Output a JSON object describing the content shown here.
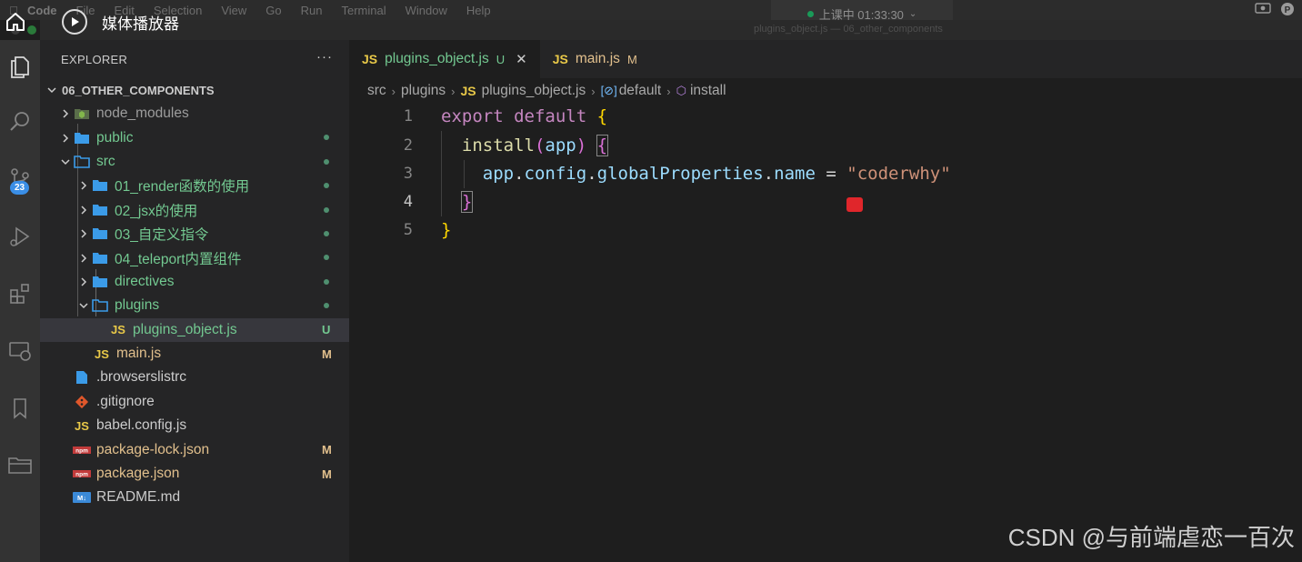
{
  "menubar": {
    "items": [
      "Code",
      "File",
      "Edit",
      "Selection",
      "View",
      "Go",
      "Run",
      "Terminal",
      "Window",
      "Help"
    ]
  },
  "status_pill": {
    "text": "上课中 01:33:30"
  },
  "window_title": "plugins_object.js — 06_other_components",
  "media_overlay": {
    "title": "媒体播放器"
  },
  "activity_bar": {
    "source_control_badge": "23"
  },
  "sidebar": {
    "header": "EXPLORER",
    "more": "···",
    "section": "06_OTHER_COMPONENTS",
    "items": [
      {
        "label": "node_modules",
        "deco": ""
      },
      {
        "label": "public",
        "deco": ""
      },
      {
        "label": "src",
        "deco": ""
      },
      {
        "label": "01_render函数的使用",
        "deco": ""
      },
      {
        "label": "02_jsx的使用",
        "deco": ""
      },
      {
        "label": "03_自定义指令",
        "deco": ""
      },
      {
        "label": "04_teleport内置组件",
        "deco": ""
      },
      {
        "label": "directives",
        "deco": ""
      },
      {
        "label": "plugins",
        "deco": ""
      },
      {
        "label": "plugins_object.js",
        "deco": "U"
      },
      {
        "label": "main.js",
        "deco": "M"
      },
      {
        "label": ".browserslistrc",
        "deco": ""
      },
      {
        "label": ".gitignore",
        "deco": ""
      },
      {
        "label": "babel.config.js",
        "deco": ""
      },
      {
        "label": "package-lock.json",
        "deco": "M"
      },
      {
        "label": "package.json",
        "deco": "M"
      },
      {
        "label": "README.md",
        "deco": ""
      }
    ]
  },
  "tabs": [
    {
      "icon": "JS",
      "label": "plugins_object.js",
      "deco": "U",
      "close": "✕"
    },
    {
      "icon": "JS",
      "label": "main.js",
      "deco": "M"
    }
  ],
  "breadcrumb": {
    "parts": [
      "src",
      "plugins",
      "plugins_object.js",
      "default",
      "install"
    ],
    "js_icon": "JS"
  },
  "editor": {
    "line_numbers": [
      "1",
      "2",
      "3",
      "4",
      "5"
    ],
    "tokens": {
      "export": "export",
      "default": "default",
      "brace_open": "{",
      "brace_close": "}",
      "install": "install",
      "paren_open": "(",
      "app": "app",
      "paren_close": ")",
      "dot": ".",
      "config": "config",
      "globalProperties": "globalProperties",
      "name": "name",
      "equals": "=",
      "string": "\"coderwhy\""
    }
  },
  "watermark": "CSDN @与前端虐恋一百次",
  "colors": {
    "accent_badge": "#3a8ee6",
    "untracked": "#73c991",
    "modified": "#e2c08d",
    "record_red": "#e0262b"
  }
}
